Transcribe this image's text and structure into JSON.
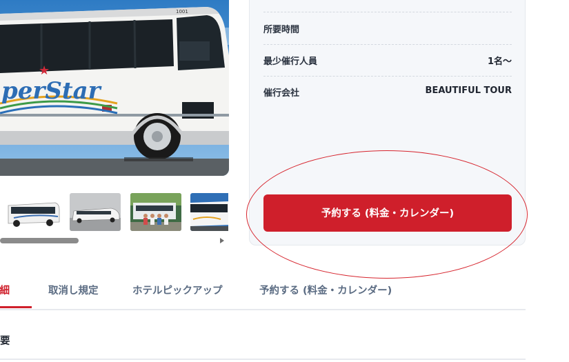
{
  "gallery": {
    "main_image_icon": "coach-bus-photo",
    "main_logo_text": "perStar",
    "bus_number": "1001",
    "thumbnails": [
      {
        "icon": "minibus-photo"
      },
      {
        "icon": "limousine-photo"
      },
      {
        "icon": "group-with-bus-photo"
      },
      {
        "icon": "coach-bus-photo"
      }
    ]
  },
  "info": {
    "rows": [
      {
        "label": "所要時間",
        "value": ""
      },
      {
        "label": "最少催行人員",
        "value": "1名〜"
      },
      {
        "label": "催行会社",
        "value": "BEAUTIFUL TOUR"
      }
    ],
    "book_button": "予約する (料金・カレンダー)"
  },
  "tabs": {
    "items": [
      {
        "label": "詳細"
      },
      {
        "label": "取消し規定"
      },
      {
        "label": "ホテルピックアップ"
      },
      {
        "label": "予約する (料金・カレンダー)"
      }
    ]
  },
  "section": {
    "heading": "要"
  },
  "colors": {
    "accent": "#cf1f2b",
    "panel_bg": "#f5f7fa",
    "tab_text": "#5a6b82"
  }
}
